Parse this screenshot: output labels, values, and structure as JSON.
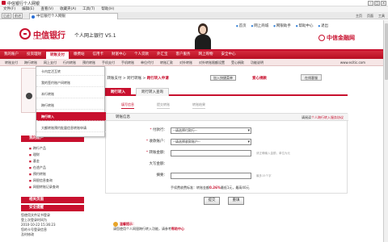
{
  "window": {
    "title": "中信银行个人网银"
  },
  "browser": {
    "menu": [
      "文件(F)",
      "编辑(E)",
      "查看(V)",
      "收藏夹(A)",
      "工具(T)",
      "帮助(H)"
    ],
    "tab_title": "中信银行个人网银",
    "nav": [
      "后退",
      "前进"
    ],
    "tools": [
      "主页",
      "页面",
      "工具"
    ]
  },
  "bank": {
    "logo_cn": "中信银行",
    "logo_en": "CHINA CITIC BANK",
    "logo_sub": "个人网上银行 V5.1",
    "top_links": [
      "首页",
      "网上商城",
      "网银助手",
      "帮助中心",
      "退出"
    ],
    "citi_tag": "中信金融网",
    "url_tag": "www.ecitic.com"
  },
  "main_nav": [
    "我的账户",
    "投资理财",
    "转账支付",
    "缴费站",
    "信用卡",
    "财富中心",
    "个人贷款",
    "外汇宝",
    "客户服务",
    "网上购物",
    "安全中心"
  ],
  "main_nav_active": "转账支付",
  "sub_nav": [
    "转账支付",
    "跨行转账",
    "网上支付",
    "行内转账",
    "预约转账",
    "手机支付",
    "手机转账",
    "单位代付",
    "转账汇款",
    "对外转账",
    "对外转账限额设置",
    "受心捐款",
    "功能说明"
  ],
  "dropdown": {
    "items": [
      "卡内定活互转",
      "我的签约账户间转账",
      "本行转账",
      "跨行转账",
      "跨行转入",
      "大额转账预约批量信息转账申请"
    ],
    "selected": "跨行转入"
  },
  "sidebar": {
    "section_title": "我的账户",
    "list": [
      "跨行产品",
      "理财",
      "基金",
      "在途产品",
      "预约转账",
      "网银信息查询",
      "网银转账记录查询"
    ],
    "safety_title": "相关页面",
    "safe_title": "安全提醒",
    "notice": [
      "您使用文件证书登录",
      "登上次登录时间为",
      "2010-10-22 15:36:23",
      "您的卡号登录信息",
      "及时修改"
    ]
  },
  "content": {
    "breadcrumb_prefix": "您的位置：转账支付 > 跨行转账 >",
    "breadcrumb_current": "跨行转入申请",
    "add_fav": "加入快捷菜单",
    "love": "爱心捐款",
    "customer_service": "在线客服",
    "tabs": [
      "跨行转入",
      "跨行转入查询"
    ],
    "steps": [
      "填写信息",
      "提交转账",
      "转账结果"
    ],
    "form_header": "转账信息",
    "form_hint_prefix": "请阅读",
    "form_hint_link": "个人跨行转入服务协议",
    "fields": {
      "payer_bank_label": "付款行：",
      "payer_bank_value": "--请选择付款行--",
      "payee_account_label": "收款账户：",
      "payee_account_value": "--请选择收款账户--",
      "amount_label": "转账金额：",
      "amount_note": "请正确输入金额，单位为元",
      "amount_cn_label": "大写金额：",
      "remark_label": "摘要：",
      "remark_note": "最多15个字"
    },
    "fee_text_prefix": "手续费收费标准：转账金额",
    "fee_text_value": "0.26%",
    "fee_text_suffix": "最低1元，最高40元",
    "submit": "提交",
    "reset": "重填",
    "tips_title": "温馨提示：",
    "tips_text": "请您使用个人网银跨行转入功能，请参考",
    "tips_link": "帮助中心"
  }
}
